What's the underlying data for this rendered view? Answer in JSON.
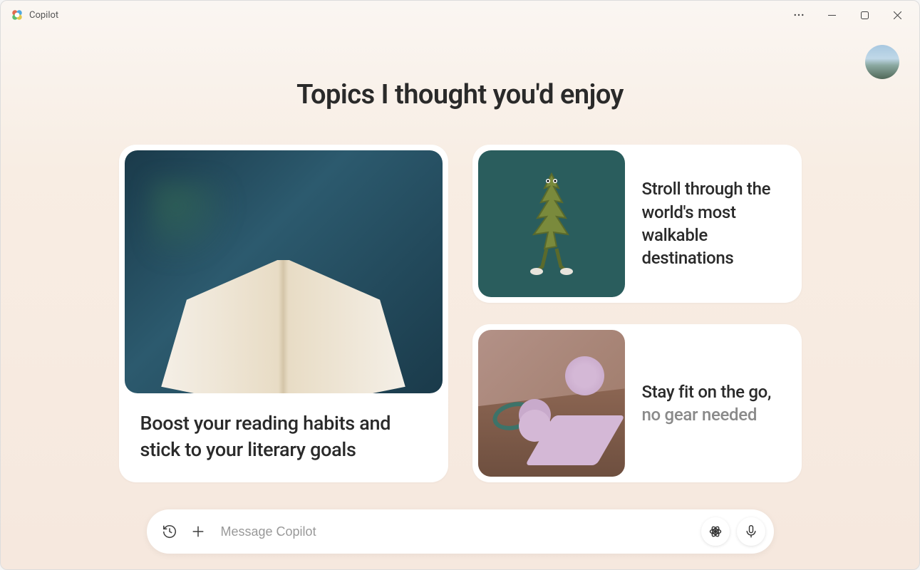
{
  "titlebar": {
    "title": "Copilot"
  },
  "heading": "Topics I thought you'd enjoy",
  "cards": {
    "large": {
      "text": "Boost your reading habits and stick to your literary goals"
    },
    "small1": {
      "text": "Stroll through the world's most walkable destinations"
    },
    "small2": {
      "text_main": "Stay fit on the go,",
      "text_sub": "no gear needed"
    }
  },
  "input": {
    "placeholder": "Message Copilot"
  }
}
